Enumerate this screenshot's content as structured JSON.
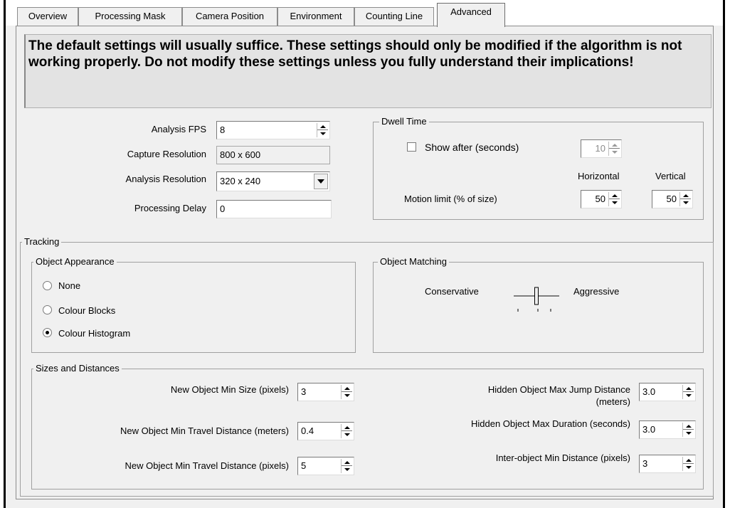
{
  "tabs": [
    "Overview",
    "Processing Mask",
    "Camera Position",
    "Environment",
    "Counting Line",
    "Advanced"
  ],
  "active_tab": "Advanced",
  "warning_text": "The default settings will usually suffice. These settings should only be modified if the algorithm is not working properly. Do not modify these settings unless you fully understand their implications!",
  "analysis": {
    "fps_label": "Analysis FPS",
    "fps_value": "8",
    "capture_label": "Capture Resolution",
    "capture_value": "800 x 600",
    "resolution_label": "Analysis Resolution",
    "resolution_value": "320 x 240",
    "delay_label": "Processing Delay",
    "delay_value": "0"
  },
  "dwell": {
    "title": "Dwell Time",
    "show_after_label": "Show after (seconds)",
    "show_after_checked": false,
    "show_after_value": "10",
    "horizontal_header": "Horizontal",
    "vertical_header": "Vertical",
    "motion_label": "Motion limit (% of size)",
    "horizontal_value": "50",
    "vertical_value": "50"
  },
  "tracking": {
    "title": "Tracking",
    "appearance": {
      "title": "Object Appearance",
      "options": [
        "None",
        "Colour Blocks",
        "Colour Histogram"
      ],
      "selected": "Colour Histogram"
    },
    "matching": {
      "title": "Object Matching",
      "left_label": "Conservative",
      "right_label": "Aggressive",
      "slider_position": 0.5
    },
    "sizes": {
      "title": "Sizes and Distances",
      "min_size_label": "New Object Min Size (pixels)",
      "min_size_value": "3",
      "min_travel_m_label": "New Object Min Travel Distance (meters)",
      "min_travel_m_value": "0.4",
      "min_travel_px_label": "New Object Min Travel Distance (pixels)",
      "min_travel_px_value": "5",
      "jump_label_1": "Hidden Object Max Jump Distance",
      "jump_label_2": "(meters)",
      "jump_value": "3.0",
      "duration_label": "Hidden Object Max Duration (seconds)",
      "duration_value": "3.0",
      "inter_label": "Inter-object Min Distance (pixels)",
      "inter_value": "3"
    }
  }
}
